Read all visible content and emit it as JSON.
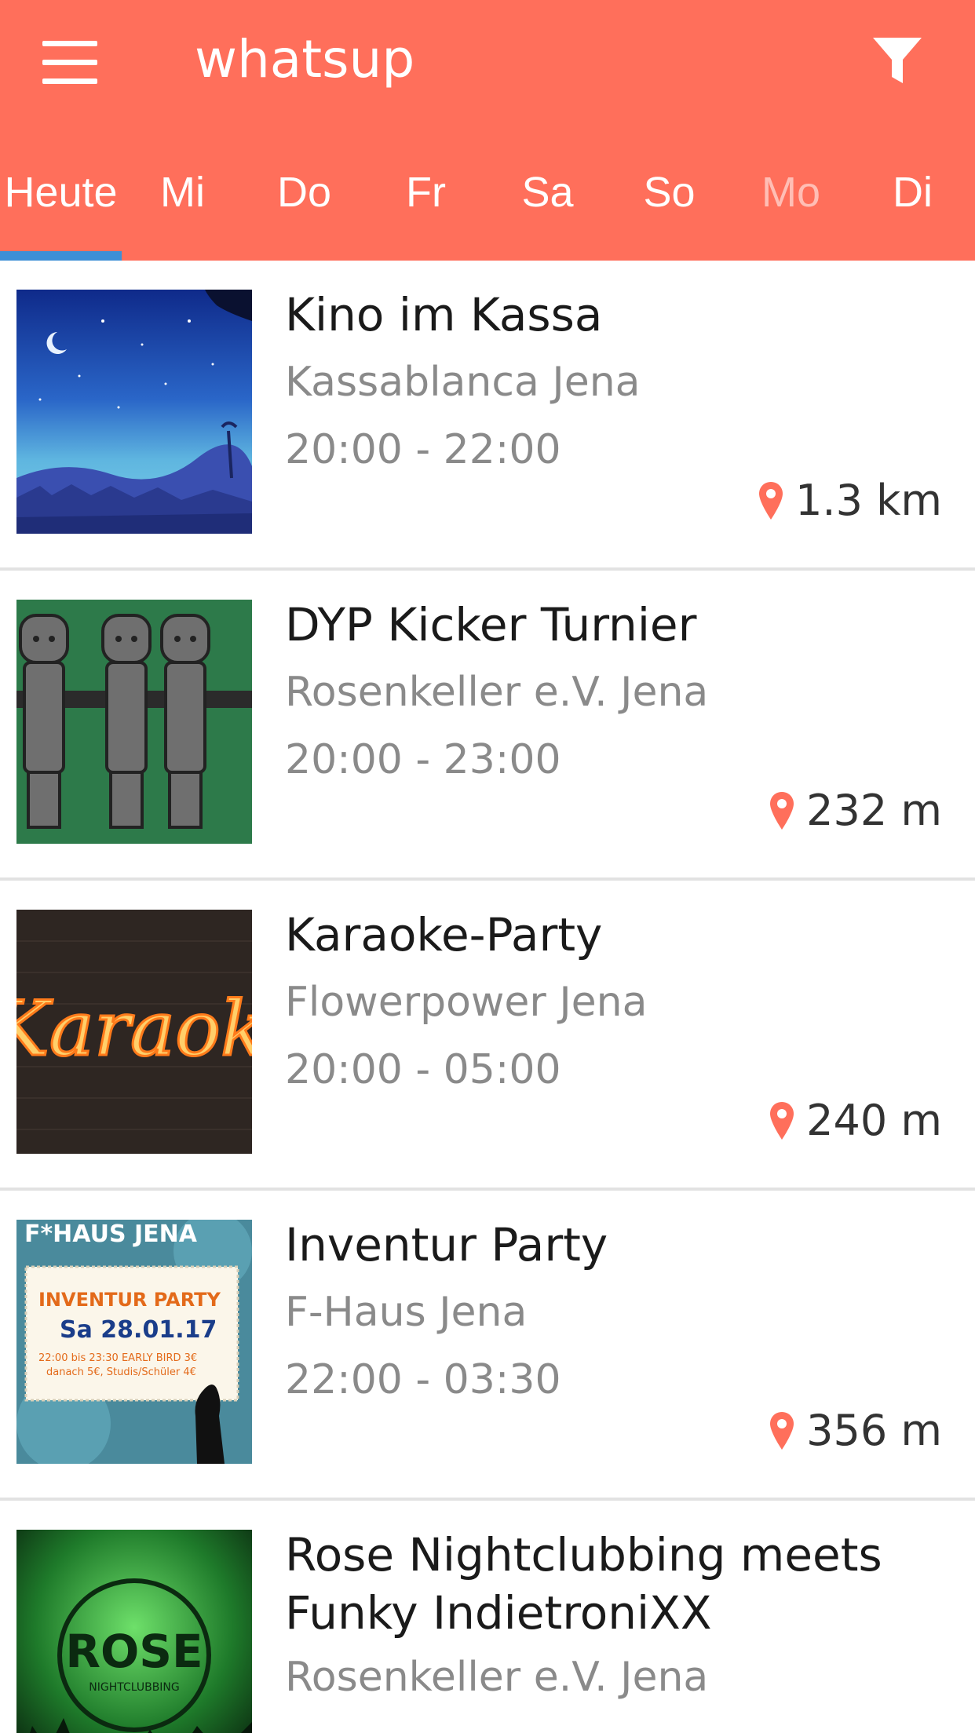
{
  "header": {
    "title": "whatsup",
    "accent_color": "#ff6f5b",
    "menu_icon": "hamburger-menu-icon",
    "filter_icon": "filter-funnel-icon"
  },
  "tabs": [
    {
      "label": "Heute",
      "selected": true
    },
    {
      "label": "Mi"
    },
    {
      "label": "Do"
    },
    {
      "label": "Fr"
    },
    {
      "label": "Sa"
    },
    {
      "label": "So"
    },
    {
      "label": "Mo",
      "dimmed": true
    },
    {
      "label": "Di"
    }
  ],
  "events": [
    {
      "title": "Kino im Kassa",
      "venue": "Kassablanca Jena",
      "time": "20:00 - 22:00",
      "distance": "1.3 km"
    },
    {
      "title": "DYP Kicker Turnier",
      "venue": "Rosenkeller e.V. Jena",
      "time": "20:00 - 23:00",
      "distance": "232 m"
    },
    {
      "title": "Karaoke-Party",
      "venue": "Flowerpower Jena",
      "time": "20:00 - 05:00",
      "distance": "240 m"
    },
    {
      "title": "Inventur Party",
      "venue": "F-Haus Jena",
      "time": "22:00 - 03:30",
      "distance": "356 m",
      "poster": {
        "header": "F*HAUS JENA",
        "line1": "INVENTUR PARTY",
        "line2": "Sa 28.01.17",
        "line3": "22:00 bis 23:30 EARLY BIRD 3€",
        "line4": "danach 5€, Studis/Schüler 4€"
      }
    },
    {
      "title": "Rose Nightclubbing meets Funky IndietroniXX",
      "venue": "Rosenkeller e.V. Jena",
      "time": "",
      "distance": "",
      "poster": {
        "logo": "ROSE",
        "sub": "NIGHTCLUBBING"
      }
    }
  ],
  "karaoke_sign": "Karaoke",
  "pin_icon": "location-pin-icon"
}
